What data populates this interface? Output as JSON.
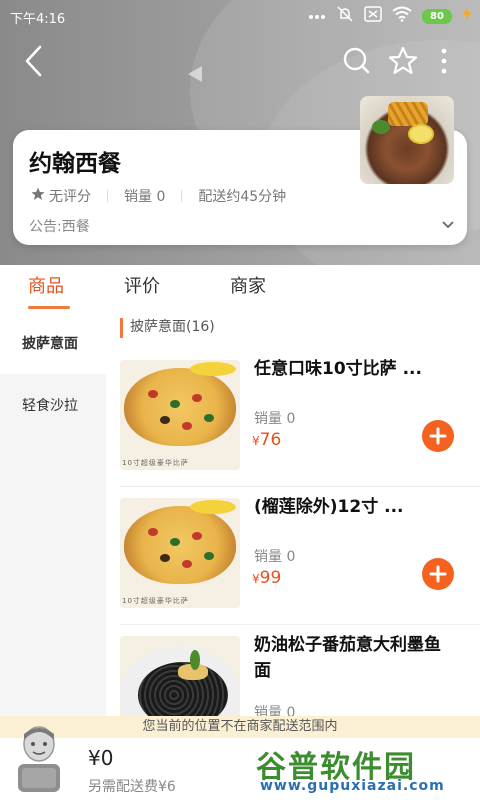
{
  "status_bar": {
    "time": "下午4:16",
    "battery": "80",
    "icons": [
      "dots-icon",
      "mute-icon",
      "sim-icon",
      "wifi-icon",
      "battery-icon",
      "charging-icon"
    ]
  },
  "nav": {
    "back_icon": "back-arrow-icon",
    "search_icon": "search-icon",
    "favorite_icon": "star-outline-icon",
    "more_icon": "more-vertical-icon"
  },
  "shop": {
    "name": "约翰西餐",
    "rating": "无评分",
    "sales": "销量 0",
    "delivery_time": "配送约45分钟",
    "notice": "公告:西餐"
  },
  "tabs": [
    {
      "label": "商品",
      "active": true
    },
    {
      "label": "评价",
      "active": false
    },
    {
      "label": "商家",
      "active": false
    }
  ],
  "categories": [
    {
      "label": "披萨意面",
      "active": true
    },
    {
      "label": "轻食沙拉",
      "active": false
    }
  ],
  "section_title": "披萨意面(16)",
  "products": [
    {
      "title": "任意口味10寸比萨 ...",
      "sales": "销量 0",
      "currency": "¥",
      "price": "76",
      "image_caption": "10寸超级豪华比萨"
    },
    {
      "title": "(榴莲除外)12寸 ...",
      "sales": "销量 0",
      "currency": "¥",
      "price": "99",
      "image_caption": "10寸超级豪华比萨"
    },
    {
      "title": "奶油松子番茄意大利墨鱼面",
      "sales": "销量 0",
      "currency": "¥",
      "price": ""
    }
  ],
  "cart": {
    "range_notice": "您当前的位置不在商家配送范围内",
    "total": "¥0",
    "delivery_fee": "另需配送费¥6"
  },
  "watermark": {
    "text": "谷普软件园",
    "url": "www.gupuxiazai.com"
  },
  "colors": {
    "accent": "#e8501c",
    "add_button": "#f5621f",
    "notice_bg": "#fbf0d4"
  }
}
